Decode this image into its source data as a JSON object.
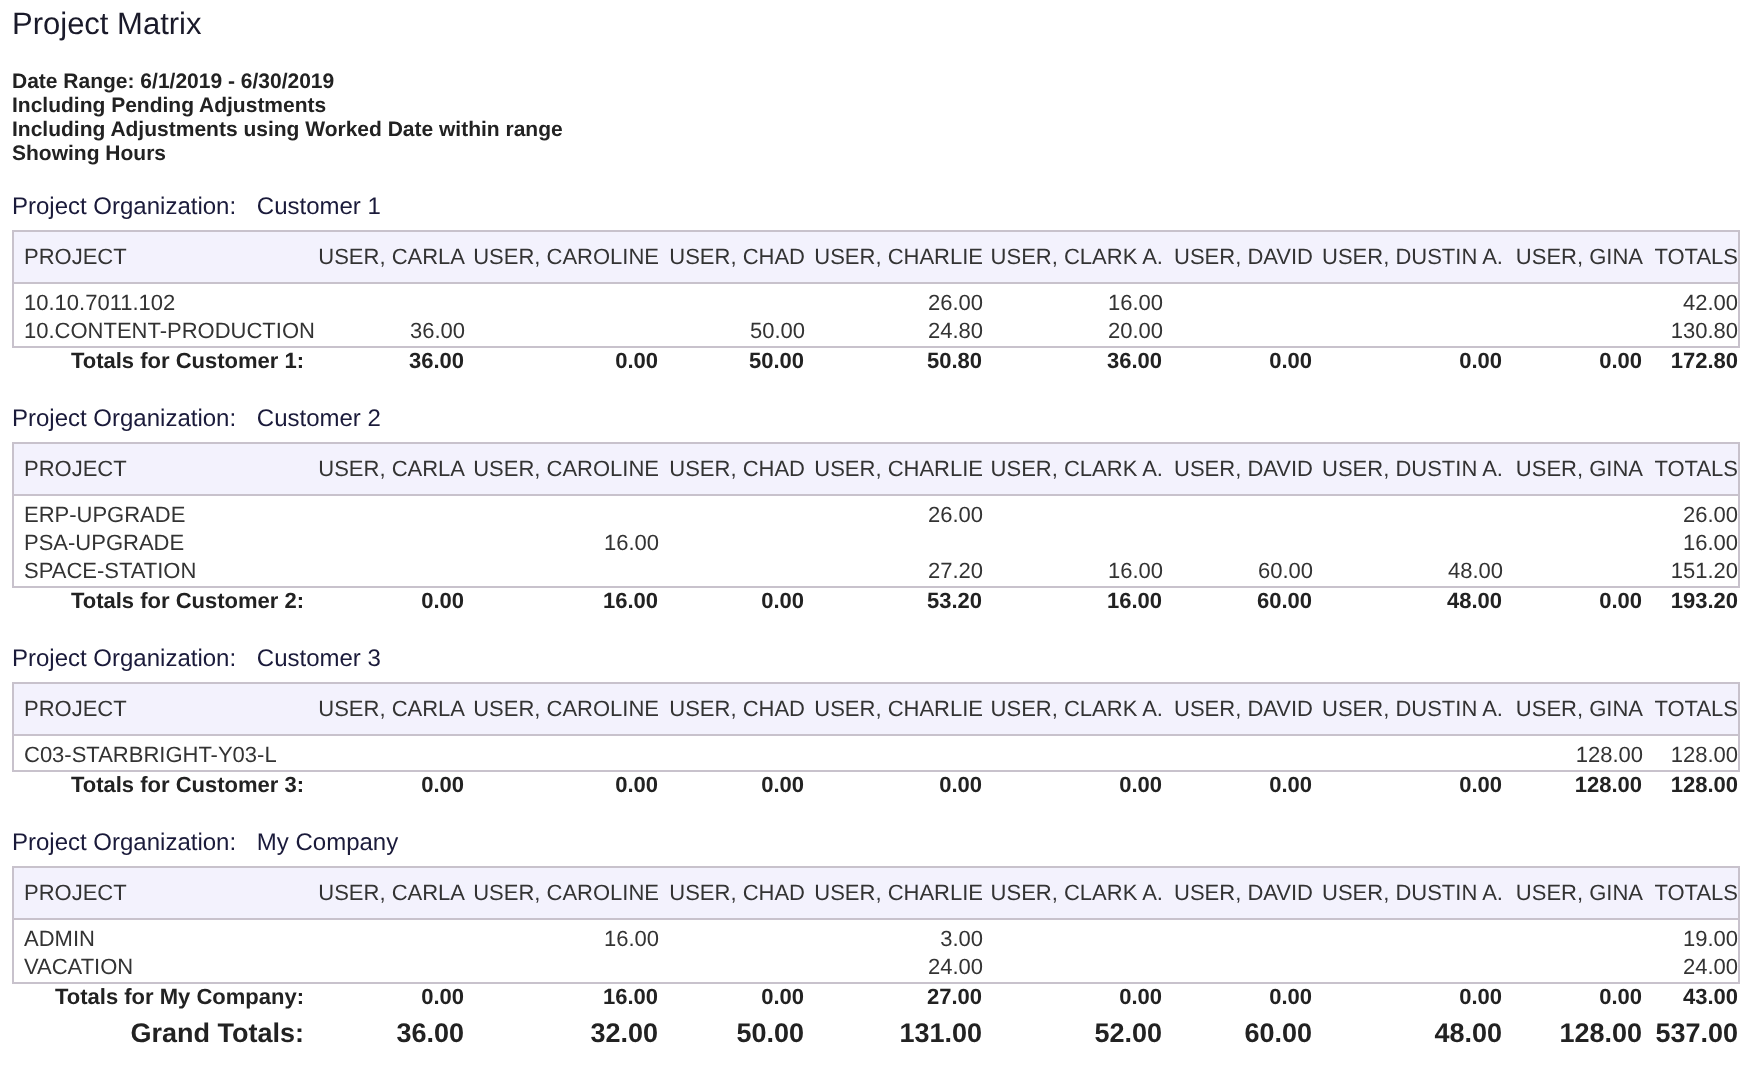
{
  "title": "Project Matrix",
  "filters": [
    "**Date Range:** 6/1/2019 - 6/30/2019",
    "Including Pending Adjustments",
    "Including Adjustments using Worked Date within range",
    "Showing Hours"
  ],
  "groups": [
    {
      "label": "Project Organization:",
      "name": "Customer 1",
      "columns": [
        "PROJECT",
        "USER, CARLA",
        "USER, CAROLINE",
        "USER, CHAD",
        "USER, CHARLIE",
        "USER, CLARK A.",
        "USER, DAVID",
        "USER, DUSTIN A.",
        "USER, GINA",
        "TOTALS"
      ],
      "rows": [
        {
          "project": "10.10.7011.102",
          "cells": {
            "charlie": "26.00",
            "clark_a": "16.00",
            "totals": "42.00"
          }
        },
        {
          "project": "10.CONTENT-PRODUCTION",
          "cells": {
            "carla": "36.00",
            "chad": "50.00",
            "charlie": "24.80",
            "clark_a": "20.00",
            "totals": "130.80"
          }
        }
      ],
      "totals": {
        "label": "Totals for Customer 1:",
        "values": [
          "36.00",
          "0.00",
          "50.00",
          "50.80",
          "36.00",
          "0.00",
          "0.00",
          "0.00",
          "172.80"
        ]
      }
    },
    {
      "label": "Project Organization:",
      "name": "Customer 2",
      "columns": [
        "PROJECT",
        "USER, CARLA",
        "USER, CAROLINE",
        "USER, CHAD",
        "USER, CHARLIE",
        "USER, CLARK A.",
        "USER, DAVID",
        "USER, DUSTIN A.",
        "USER, GINA",
        "TOTALS"
      ],
      "rows": [
        {
          "project": "ERP-UPGRADE",
          "cells": {
            "charlie": "26.00",
            "totals": "26.00"
          }
        },
        {
          "project": "PSA-UPGRADE",
          "cells": {
            "caroline": "16.00",
            "totals": "16.00"
          }
        },
        {
          "project": "SPACE-STATION",
          "cells": {
            "charlie": "27.20",
            "clark_a": "16.00",
            "david": "60.00",
            "dustin_a": "48.00",
            "totals": "151.20"
          }
        }
      ],
      "totals": {
        "label": "Totals for Customer 2:",
        "values": [
          "0.00",
          "16.00",
          "0.00",
          "53.20",
          "16.00",
          "60.00",
          "48.00",
          "0.00",
          "193.20"
        ]
      }
    },
    {
      "label": "Project Organization:",
      "name": "Customer 3",
      "columns": [
        "PROJECT",
        "USER, CARLA",
        "USER, CAROLINE",
        "USER, CHAD",
        "USER, CHARLIE",
        "USER, CLARK A.",
        "USER, DAVID",
        "USER, DUSTIN A.",
        "USER, GINA",
        "TOTALS"
      ],
      "rows": [
        {
          "project": "C03-STARBRIGHT-Y03-L",
          "cells": {
            "gina": "128.00",
            "totals": "128.00"
          }
        }
      ],
      "totals": {
        "label": "Totals for Customer 3:",
        "values": [
          "0.00",
          "0.00",
          "0.00",
          "0.00",
          "0.00",
          "0.00",
          "0.00",
          "128.00",
          "128.00"
        ]
      }
    },
    {
      "label": "Project Organization:",
      "name": "My Company",
      "columns": [
        "PROJECT",
        "USER, CARLA",
        "USER, CAROLINE",
        "USER, CHAD",
        "USER, CHARLIE",
        "USER, CLARK A.",
        "USER, DAVID",
        "USER, DUSTIN A.",
        "USER, GINA",
        "TOTALS"
      ],
      "rows": [
        {
          "project": "ADMIN",
          "cells": {
            "caroline": "16.00",
            "charlie": "3.00",
            "totals": "19.00"
          }
        },
        {
          "project": "VACATION",
          "cells": {
            "charlie": "24.00",
            "totals": "24.00"
          }
        }
      ],
      "totals": {
        "label": "Totals for My Company:",
        "values": [
          "0.00",
          "16.00",
          "0.00",
          "27.00",
          "0.00",
          "0.00",
          "0.00",
          "0.00",
          "43.00"
        ]
      }
    }
  ],
  "grand_totals": {
    "label": "Grand Totals:",
    "values": [
      "36.00",
      "32.00",
      "50.00",
      "131.00",
      "52.00",
      "60.00",
      "48.00",
      "128.00",
      "537.00"
    ]
  }
}
